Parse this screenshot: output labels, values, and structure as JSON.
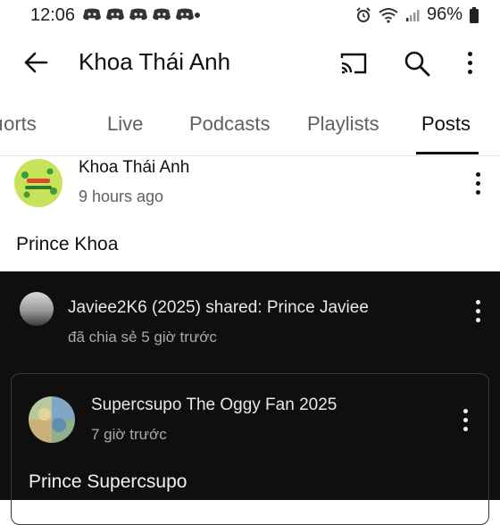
{
  "status_bar": {
    "time": "12:06",
    "battery": "96%"
  },
  "app_bar": {
    "title": "Khoa Thái Anh",
    "icons": [
      "back-arrow-icon",
      "cast-icon",
      "search-icon",
      "more-vert-icon"
    ]
  },
  "tabs": [
    {
      "label": "ıorts",
      "active": false
    },
    {
      "label": "Live",
      "active": false
    },
    {
      "label": "Podcasts",
      "active": false
    },
    {
      "label": "Playlists",
      "active": false
    },
    {
      "label": "Posts",
      "active": true
    }
  ],
  "post": {
    "author": "Khoa Thái Anh",
    "time": "9 hours ago",
    "text": "Prince Khoa"
  },
  "shared_post": {
    "author_line": "Javiee2K6 (2025) shared: Prince Javiee",
    "time": "đã chia sẻ 5 giờ trước",
    "inner": {
      "author": "Supercsupo The Oggy Fan 2025",
      "time": "7 giờ trước",
      "text": "Prince Supercsupo"
    }
  },
  "colors": {
    "text_primary": "#0f0f0f",
    "text_secondary": "#606060",
    "dark_bg": "#0f0f0f",
    "avatar_green": "#c6e35a"
  }
}
